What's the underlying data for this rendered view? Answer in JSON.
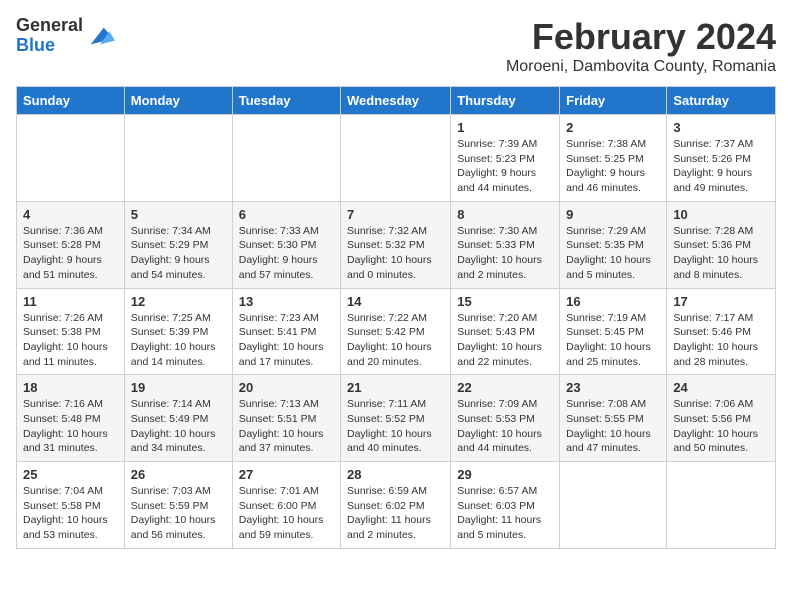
{
  "logo": {
    "general": "General",
    "blue": "Blue"
  },
  "title": "February 2024",
  "subtitle": "Moroeni, Dambovita County, Romania",
  "days_of_week": [
    "Sunday",
    "Monday",
    "Tuesday",
    "Wednesday",
    "Thursday",
    "Friday",
    "Saturday"
  ],
  "weeks": [
    [
      {
        "day": "",
        "info": ""
      },
      {
        "day": "",
        "info": ""
      },
      {
        "day": "",
        "info": ""
      },
      {
        "day": "",
        "info": ""
      },
      {
        "day": "1",
        "info": "Sunrise: 7:39 AM\nSunset: 5:23 PM\nDaylight: 9 hours and 44 minutes."
      },
      {
        "day": "2",
        "info": "Sunrise: 7:38 AM\nSunset: 5:25 PM\nDaylight: 9 hours and 46 minutes."
      },
      {
        "day": "3",
        "info": "Sunrise: 7:37 AM\nSunset: 5:26 PM\nDaylight: 9 hours and 49 minutes."
      }
    ],
    [
      {
        "day": "4",
        "info": "Sunrise: 7:36 AM\nSunset: 5:28 PM\nDaylight: 9 hours and 51 minutes."
      },
      {
        "day": "5",
        "info": "Sunrise: 7:34 AM\nSunset: 5:29 PM\nDaylight: 9 hours and 54 minutes."
      },
      {
        "day": "6",
        "info": "Sunrise: 7:33 AM\nSunset: 5:30 PM\nDaylight: 9 hours and 57 minutes."
      },
      {
        "day": "7",
        "info": "Sunrise: 7:32 AM\nSunset: 5:32 PM\nDaylight: 10 hours and 0 minutes."
      },
      {
        "day": "8",
        "info": "Sunrise: 7:30 AM\nSunset: 5:33 PM\nDaylight: 10 hours and 2 minutes."
      },
      {
        "day": "9",
        "info": "Sunrise: 7:29 AM\nSunset: 5:35 PM\nDaylight: 10 hours and 5 minutes."
      },
      {
        "day": "10",
        "info": "Sunrise: 7:28 AM\nSunset: 5:36 PM\nDaylight: 10 hours and 8 minutes."
      }
    ],
    [
      {
        "day": "11",
        "info": "Sunrise: 7:26 AM\nSunset: 5:38 PM\nDaylight: 10 hours and 11 minutes."
      },
      {
        "day": "12",
        "info": "Sunrise: 7:25 AM\nSunset: 5:39 PM\nDaylight: 10 hours and 14 minutes."
      },
      {
        "day": "13",
        "info": "Sunrise: 7:23 AM\nSunset: 5:41 PM\nDaylight: 10 hours and 17 minutes."
      },
      {
        "day": "14",
        "info": "Sunrise: 7:22 AM\nSunset: 5:42 PM\nDaylight: 10 hours and 20 minutes."
      },
      {
        "day": "15",
        "info": "Sunrise: 7:20 AM\nSunset: 5:43 PM\nDaylight: 10 hours and 22 minutes."
      },
      {
        "day": "16",
        "info": "Sunrise: 7:19 AM\nSunset: 5:45 PM\nDaylight: 10 hours and 25 minutes."
      },
      {
        "day": "17",
        "info": "Sunrise: 7:17 AM\nSunset: 5:46 PM\nDaylight: 10 hours and 28 minutes."
      }
    ],
    [
      {
        "day": "18",
        "info": "Sunrise: 7:16 AM\nSunset: 5:48 PM\nDaylight: 10 hours and 31 minutes."
      },
      {
        "day": "19",
        "info": "Sunrise: 7:14 AM\nSunset: 5:49 PM\nDaylight: 10 hours and 34 minutes."
      },
      {
        "day": "20",
        "info": "Sunrise: 7:13 AM\nSunset: 5:51 PM\nDaylight: 10 hours and 37 minutes."
      },
      {
        "day": "21",
        "info": "Sunrise: 7:11 AM\nSunset: 5:52 PM\nDaylight: 10 hours and 40 minutes."
      },
      {
        "day": "22",
        "info": "Sunrise: 7:09 AM\nSunset: 5:53 PM\nDaylight: 10 hours and 44 minutes."
      },
      {
        "day": "23",
        "info": "Sunrise: 7:08 AM\nSunset: 5:55 PM\nDaylight: 10 hours and 47 minutes."
      },
      {
        "day": "24",
        "info": "Sunrise: 7:06 AM\nSunset: 5:56 PM\nDaylight: 10 hours and 50 minutes."
      }
    ],
    [
      {
        "day": "25",
        "info": "Sunrise: 7:04 AM\nSunset: 5:58 PM\nDaylight: 10 hours and 53 minutes."
      },
      {
        "day": "26",
        "info": "Sunrise: 7:03 AM\nSunset: 5:59 PM\nDaylight: 10 hours and 56 minutes."
      },
      {
        "day": "27",
        "info": "Sunrise: 7:01 AM\nSunset: 6:00 PM\nDaylight: 10 hours and 59 minutes."
      },
      {
        "day": "28",
        "info": "Sunrise: 6:59 AM\nSunset: 6:02 PM\nDaylight: 11 hours and 2 minutes."
      },
      {
        "day": "29",
        "info": "Sunrise: 6:57 AM\nSunset: 6:03 PM\nDaylight: 11 hours and 5 minutes."
      },
      {
        "day": "",
        "info": ""
      },
      {
        "day": "",
        "info": ""
      }
    ]
  ]
}
